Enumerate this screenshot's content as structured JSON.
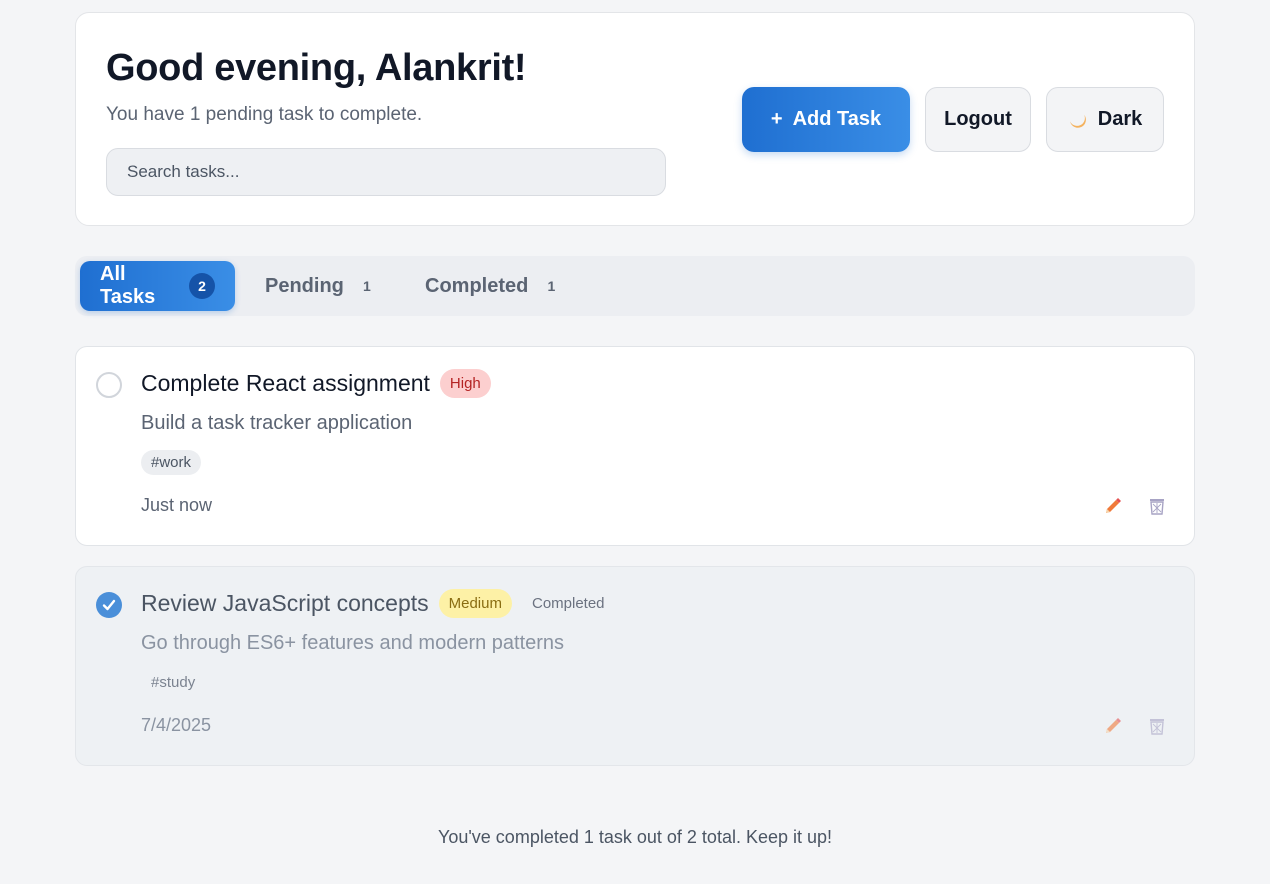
{
  "header": {
    "greeting": "Good evening, Alankrit!",
    "subtitle": "You have 1 pending task to complete.",
    "search_placeholder": "Search tasks...",
    "add_button_icon": "+",
    "add_button_label": "Add Task",
    "logout_label": "Logout",
    "theme_icon": "moon-icon",
    "theme_label": "Dark"
  },
  "tabs": [
    {
      "label": "All Tasks",
      "count": "2",
      "active": true
    },
    {
      "label": "Pending",
      "count": "1",
      "active": false
    },
    {
      "label": "Completed",
      "count": "1",
      "active": false
    }
  ],
  "tasks": [
    {
      "title": "Complete React assignment",
      "priority": "High",
      "status": "",
      "description": "Build a task tracker application",
      "tag": "#work",
      "time": "Just now",
      "completed": false
    },
    {
      "title": "Review JavaScript concepts",
      "priority": "Medium",
      "status": "Completed",
      "description": "Go through ES6+ features and modern patterns",
      "tag": "#study",
      "time": "7/4/2025",
      "completed": true
    }
  ],
  "footer": {
    "text": "You've completed 1 task out of 2 total. Keep it up!"
  },
  "colors": {
    "accent": "#2a7fdd",
    "high_badge_bg": "#fccfcf",
    "medium_badge_bg": "#fdf1a6",
    "edit_icon": "#f07a3a",
    "delete_icon": "#a7a3c4"
  }
}
